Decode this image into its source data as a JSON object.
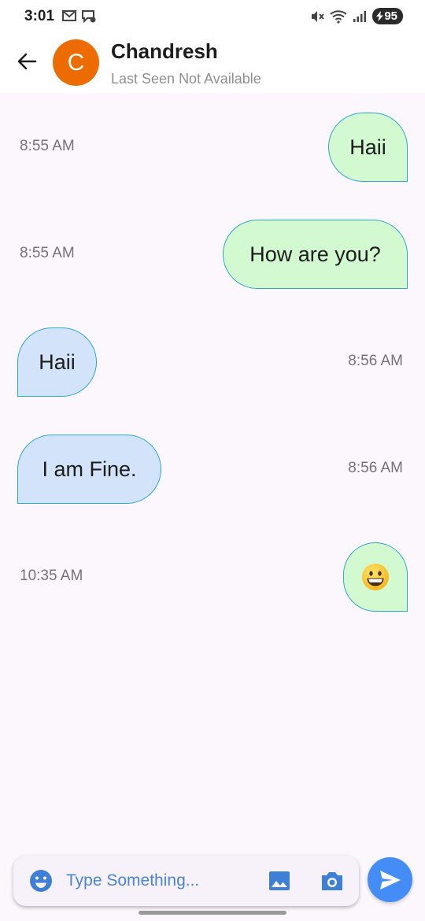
{
  "status_bar": {
    "time": "3:01",
    "battery": "95"
  },
  "header": {
    "avatar_letter": "C",
    "contact_name": "Chandresh",
    "last_seen": "Last Seen Not Available"
  },
  "messages": [
    {
      "text": "Haii",
      "time": "8:55 AM",
      "direction": "sent"
    },
    {
      "text": "How are you?",
      "time": "8:55 AM",
      "direction": "sent"
    },
    {
      "text": "Haii",
      "time": "8:56 AM",
      "direction": "received"
    },
    {
      "text": "I am Fine.",
      "time": "8:56 AM",
      "direction": "received"
    },
    {
      "text": "",
      "emoji": "grinning-face",
      "time": "10:35 AM",
      "direction": "sent"
    }
  ],
  "input": {
    "placeholder": "Type Something...",
    "value": ""
  },
  "colors": {
    "sent_bubble": "#d2f9cf",
    "received_bubble": "#d3e4fa",
    "bubble_border": "#2aa8d4",
    "avatar": "#ed6c02",
    "send_button": "#448df7",
    "icon_accent": "#3f7fd6"
  },
  "icons": {
    "back": "arrow-left-icon",
    "emoji": "emoji-smile-icon",
    "gallery": "image-icon",
    "camera": "camera-icon",
    "send": "send-icon"
  }
}
